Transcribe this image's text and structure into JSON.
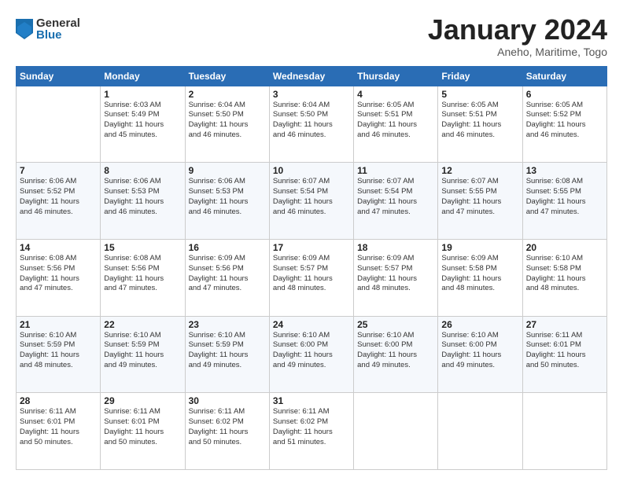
{
  "header": {
    "logo_general": "General",
    "logo_blue": "Blue",
    "title": "January 2024",
    "subtitle": "Aneho, Maritime, Togo"
  },
  "days_of_week": [
    "Sunday",
    "Monday",
    "Tuesday",
    "Wednesday",
    "Thursday",
    "Friday",
    "Saturday"
  ],
  "weeks": [
    [
      {
        "day": "",
        "info": ""
      },
      {
        "day": "1",
        "info": "Sunrise: 6:03 AM\nSunset: 5:49 PM\nDaylight: 11 hours\nand 45 minutes."
      },
      {
        "day": "2",
        "info": "Sunrise: 6:04 AM\nSunset: 5:50 PM\nDaylight: 11 hours\nand 46 minutes."
      },
      {
        "day": "3",
        "info": "Sunrise: 6:04 AM\nSunset: 5:50 PM\nDaylight: 11 hours\nand 46 minutes."
      },
      {
        "day": "4",
        "info": "Sunrise: 6:05 AM\nSunset: 5:51 PM\nDaylight: 11 hours\nand 46 minutes."
      },
      {
        "day": "5",
        "info": "Sunrise: 6:05 AM\nSunset: 5:51 PM\nDaylight: 11 hours\nand 46 minutes."
      },
      {
        "day": "6",
        "info": "Sunrise: 6:05 AM\nSunset: 5:52 PM\nDaylight: 11 hours\nand 46 minutes."
      }
    ],
    [
      {
        "day": "7",
        "info": "Sunrise: 6:06 AM\nSunset: 5:52 PM\nDaylight: 11 hours\nand 46 minutes."
      },
      {
        "day": "8",
        "info": "Sunrise: 6:06 AM\nSunset: 5:53 PM\nDaylight: 11 hours\nand 46 minutes."
      },
      {
        "day": "9",
        "info": "Sunrise: 6:06 AM\nSunset: 5:53 PM\nDaylight: 11 hours\nand 46 minutes."
      },
      {
        "day": "10",
        "info": "Sunrise: 6:07 AM\nSunset: 5:54 PM\nDaylight: 11 hours\nand 46 minutes."
      },
      {
        "day": "11",
        "info": "Sunrise: 6:07 AM\nSunset: 5:54 PM\nDaylight: 11 hours\nand 47 minutes."
      },
      {
        "day": "12",
        "info": "Sunrise: 6:07 AM\nSunset: 5:55 PM\nDaylight: 11 hours\nand 47 minutes."
      },
      {
        "day": "13",
        "info": "Sunrise: 6:08 AM\nSunset: 5:55 PM\nDaylight: 11 hours\nand 47 minutes."
      }
    ],
    [
      {
        "day": "14",
        "info": "Sunrise: 6:08 AM\nSunset: 5:56 PM\nDaylight: 11 hours\nand 47 minutes."
      },
      {
        "day": "15",
        "info": "Sunrise: 6:08 AM\nSunset: 5:56 PM\nDaylight: 11 hours\nand 47 minutes."
      },
      {
        "day": "16",
        "info": "Sunrise: 6:09 AM\nSunset: 5:56 PM\nDaylight: 11 hours\nand 47 minutes."
      },
      {
        "day": "17",
        "info": "Sunrise: 6:09 AM\nSunset: 5:57 PM\nDaylight: 11 hours\nand 48 minutes."
      },
      {
        "day": "18",
        "info": "Sunrise: 6:09 AM\nSunset: 5:57 PM\nDaylight: 11 hours\nand 48 minutes."
      },
      {
        "day": "19",
        "info": "Sunrise: 6:09 AM\nSunset: 5:58 PM\nDaylight: 11 hours\nand 48 minutes."
      },
      {
        "day": "20",
        "info": "Sunrise: 6:10 AM\nSunset: 5:58 PM\nDaylight: 11 hours\nand 48 minutes."
      }
    ],
    [
      {
        "day": "21",
        "info": "Sunrise: 6:10 AM\nSunset: 5:59 PM\nDaylight: 11 hours\nand 48 minutes."
      },
      {
        "day": "22",
        "info": "Sunrise: 6:10 AM\nSunset: 5:59 PM\nDaylight: 11 hours\nand 49 minutes."
      },
      {
        "day": "23",
        "info": "Sunrise: 6:10 AM\nSunset: 5:59 PM\nDaylight: 11 hours\nand 49 minutes."
      },
      {
        "day": "24",
        "info": "Sunrise: 6:10 AM\nSunset: 6:00 PM\nDaylight: 11 hours\nand 49 minutes."
      },
      {
        "day": "25",
        "info": "Sunrise: 6:10 AM\nSunset: 6:00 PM\nDaylight: 11 hours\nand 49 minutes."
      },
      {
        "day": "26",
        "info": "Sunrise: 6:10 AM\nSunset: 6:00 PM\nDaylight: 11 hours\nand 49 minutes."
      },
      {
        "day": "27",
        "info": "Sunrise: 6:11 AM\nSunset: 6:01 PM\nDaylight: 11 hours\nand 50 minutes."
      }
    ],
    [
      {
        "day": "28",
        "info": "Sunrise: 6:11 AM\nSunset: 6:01 PM\nDaylight: 11 hours\nand 50 minutes."
      },
      {
        "day": "29",
        "info": "Sunrise: 6:11 AM\nSunset: 6:01 PM\nDaylight: 11 hours\nand 50 minutes."
      },
      {
        "day": "30",
        "info": "Sunrise: 6:11 AM\nSunset: 6:02 PM\nDaylight: 11 hours\nand 50 minutes."
      },
      {
        "day": "31",
        "info": "Sunrise: 6:11 AM\nSunset: 6:02 PM\nDaylight: 11 hours\nand 51 minutes."
      },
      {
        "day": "",
        "info": ""
      },
      {
        "day": "",
        "info": ""
      },
      {
        "day": "",
        "info": ""
      }
    ]
  ]
}
